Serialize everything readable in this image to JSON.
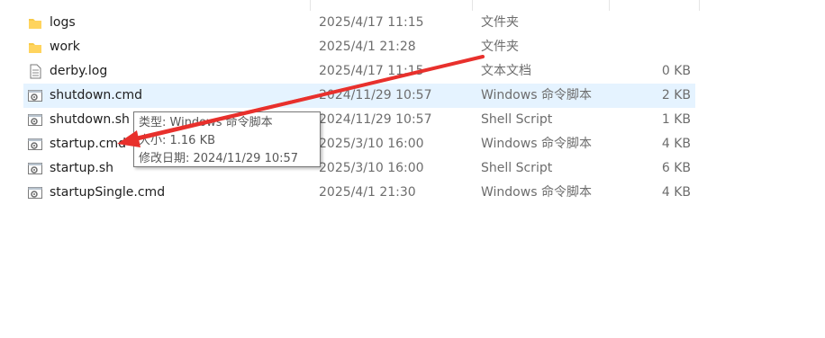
{
  "files": [
    {
      "name": "logs",
      "date": "2025/4/17 11:15",
      "type": "文件夹",
      "size": "",
      "icon": "folder-icon"
    },
    {
      "name": "work",
      "date": "2025/4/1 21:28",
      "type": "文件夹",
      "size": "",
      "icon": "folder-icon"
    },
    {
      "name": "derby.log",
      "date": "2025/4/17 11:15",
      "type": "文本文档",
      "size": "0 KB",
      "icon": "text-document-icon"
    },
    {
      "name": "shutdown.cmd",
      "date": "2024/11/29 10:57",
      "type": "Windows 命令脚本",
      "size": "2 KB",
      "icon": "script-file-icon"
    },
    {
      "name": "shutdown.sh",
      "date": "2024/11/29 10:57",
      "type": "Shell Script",
      "size": "1 KB",
      "icon": "script-file-icon"
    },
    {
      "name": "startup.cmd",
      "date": "2025/3/10 16:00",
      "type": "Windows 命令脚本",
      "size": "4 KB",
      "icon": "script-file-icon"
    },
    {
      "name": "startup.sh",
      "date": "2025/3/10 16:00",
      "type": "Shell Script",
      "size": "6 KB",
      "icon": "script-file-icon"
    },
    {
      "name": "startupSingle.cmd",
      "date": "2025/4/1 21:30",
      "type": "Windows 命令脚本",
      "size": "4 KB",
      "icon": "script-file-icon"
    }
  ],
  "tooltip": {
    "type_line": "类型: Windows 命令脚本",
    "size_line": "大小: 1.16 KB",
    "modified_line": "修改日期: 2024/11/29 10:57"
  },
  "colors": {
    "hover_row": "#e5f3ff",
    "annotation_arrow": "#e8302c",
    "folder": "#f7c948"
  }
}
